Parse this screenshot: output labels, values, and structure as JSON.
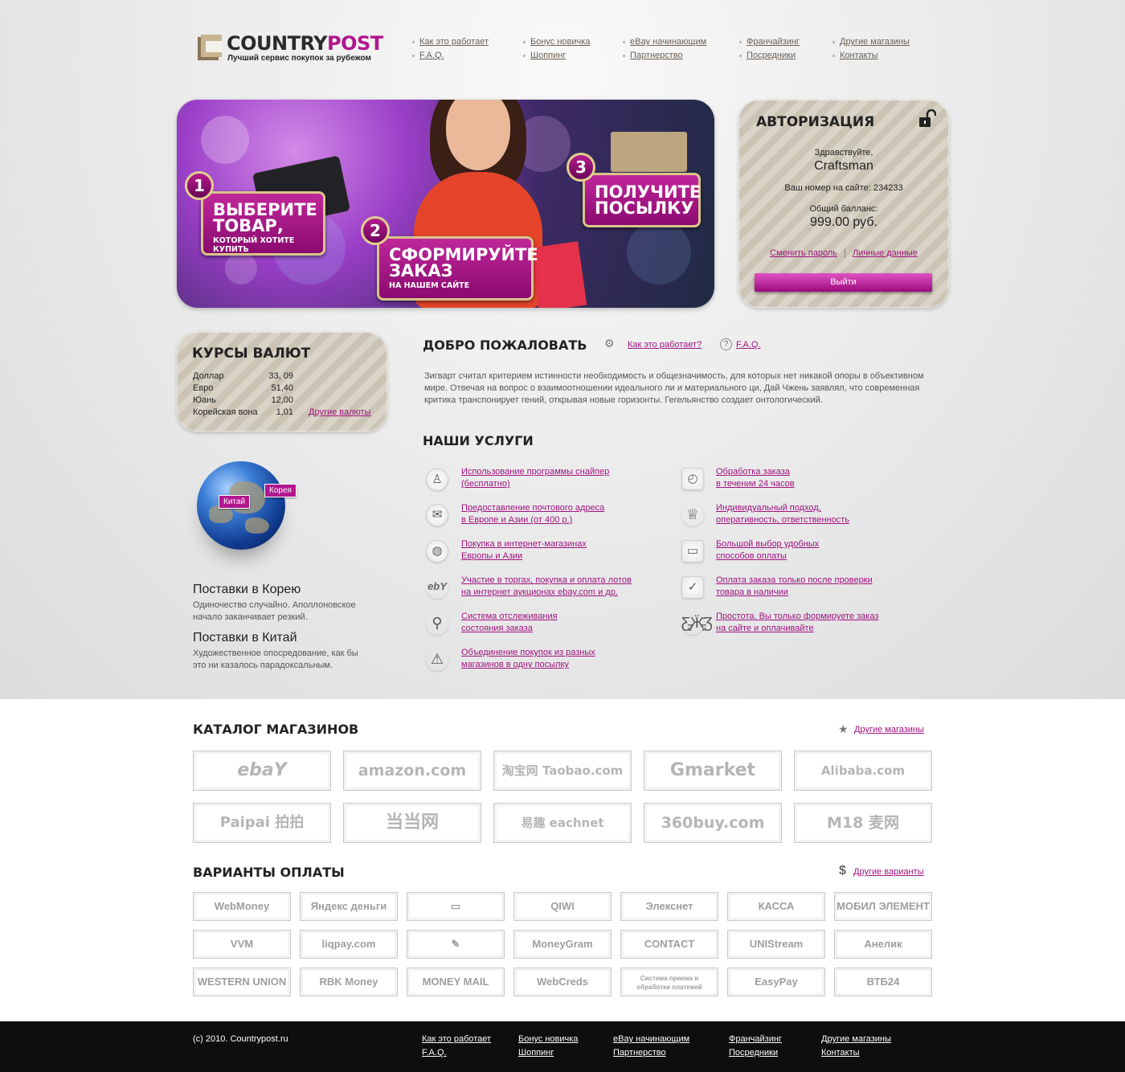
{
  "brand": {
    "name_part1": "COUNTRY",
    "name_part2": "POST",
    "tagline": "Лучший сервис покупок за рубежом"
  },
  "top_nav": [
    {
      "label": "Как это работает"
    },
    {
      "label": "F.A.Q."
    },
    {
      "label": "Бонус новичка"
    },
    {
      "label": "Шоппинг"
    },
    {
      "label": "eBay начинающим"
    },
    {
      "label": "Партнерство"
    },
    {
      "label": "Франчайзинг"
    },
    {
      "label": "Посредники"
    },
    {
      "label": "Другие магазины"
    },
    {
      "label": "Контакты"
    }
  ],
  "banner": {
    "step1": {
      "num": "1",
      "big": "ВЫБЕРИТЕ ТОВАР,",
      "small": "КОТОРЫЙ ХОТИТЕ КУПИТЬ"
    },
    "step2": {
      "num": "2",
      "big": "СФОРМИРУЙТЕ ЗАКАЗ",
      "small": "НА НАШЕМ САЙТЕ"
    },
    "step3": {
      "num": "3",
      "big": "ПОЛУЧИТЕ ПОСЫЛКУ"
    }
  },
  "auth": {
    "title": "АВТОРИЗАЦИЯ",
    "greeting": "Здравствуйте,",
    "username": "Craftsman",
    "site_number": "Ваш номер на сайте: 234233",
    "balance_label": "Общий балланс:",
    "balance_value": "999.00 руб.",
    "change_password": "Сменить пароль",
    "separator": "|",
    "personal_data": "Личные данные",
    "logout": "Выйти",
    "icon": "unlock-icon"
  },
  "rates": {
    "title": "КУРСЫ ВАЛЮТ",
    "items": [
      {
        "name": "Доллар",
        "value": "33, 09"
      },
      {
        "name": "Евро",
        "value": "51,40"
      },
      {
        "name": "Юань",
        "value": "12,00"
      },
      {
        "name": "Корейская вона",
        "value": "1,01"
      }
    ],
    "more": "Другие валюты"
  },
  "globe": {
    "tag_china": "Китай",
    "tag_korea": "Корея"
  },
  "supplies": [
    {
      "title": "Поставки в Корею",
      "text": "Одиночество случайно. Аполлоновское начало заканчивает резкий."
    },
    {
      "title": "Поставки в Китай",
      "text": "Художественное опосредование, как бы это ни казалось парадоксальным."
    }
  ],
  "welcome": {
    "title": "ДОБРО ПОЖАЛОВАТЬ",
    "how_link": "Как это работает?",
    "faq_link": "F.A.Q.",
    "text": "Зигварт считал критерием истинности необходимость и общезначимость, для которых нет никакой опоры в объективном мире. Отвечая на вопрос о взаимоотношении идеального ли и материального ци, Дай Чжень заявлял, что современная критика транспонирует гений, открывая новые горизонты. Гегельянство создает онтологический."
  },
  "services": {
    "title": "НАШИ УСЛУГИ",
    "left": [
      {
        "icon": "sniper-user-icon",
        "l1": "Использование программы снайпер",
        "l2": "(бесплатно)"
      },
      {
        "icon": "mail-icon",
        "l1": "Предоставление почтового адреса",
        "l2": "в Европе и Азии (от 400 р.)"
      },
      {
        "icon": "globe-icon",
        "l1": "Покупка в интернет-магазинах",
        "l2": "Европы и Азии"
      },
      {
        "icon": "ebay-icon",
        "l1": "Участие в торгах, покупка и оплата лотов",
        "l2": "на интернет аукционах ebay.com и др."
      },
      {
        "icon": "magnifier-icon",
        "l1": "Система отслеживания",
        "l2": "состояния заказа"
      },
      {
        "icon": "merge-icon",
        "l1": "Объединение покупок из разных",
        "l2": "магазинов в одну посылку"
      }
    ],
    "right": [
      {
        "icon": "clock-icon",
        "l1": "Обработка заказа",
        "l2": "в течении 24 часов"
      },
      {
        "icon": "chef-icon",
        "l1": "Индивидуальный подход,",
        "l2": "оперативность, ответственность"
      },
      {
        "icon": "card-icon",
        "l1": "Большой выбор удобных",
        "l2": "способов оплаты"
      },
      {
        "icon": "check-icon",
        "l1": "Оплата заказа только после проверки",
        "l2": "товара в наличии"
      },
      {
        "icon": "butterfly-icon",
        "l1": "Простота. Вы только формируете заказ",
        "l2": "на сайте и оплачивайте"
      }
    ]
  },
  "catalog": {
    "title": "КАТАЛОГ МАГАЗИНОВ",
    "more": "Другие магазины",
    "stores": [
      "ebaY",
      "amazon.com",
      "淘宝网 Taobao.com",
      "Gmarket",
      "Alibaba.com",
      "Paipai 拍拍",
      "当当网",
      "易趣 eachnet",
      "360buy.com",
      "M18 麦网"
    ]
  },
  "payments": {
    "title": "ВАРИАНТЫ ОПЛАТЫ",
    "more": "Другие варианты",
    "items": [
      "WebMoney",
      "Яндекс деньги",
      "▭",
      "QIWI",
      "Элекснет",
      "КАССА",
      "МОБИЛ ЭЛЕМЕНТ",
      "VVM",
      "liqpay.com",
      "✎",
      "MoneyGram",
      "CONTACT",
      "UNIStream",
      "Анелик",
      "WESTERN UNION",
      "RBK Money",
      "MONEY MAIL",
      "WebCreds",
      "Система приема и обработки платежей",
      "EasyPay",
      "ВТБ24"
    ]
  },
  "footer": {
    "copyright": "(c) 2010. Countrypost.ru",
    "links": [
      {
        "label": "Как это работает"
      },
      {
        "label": "F.A.Q."
      },
      {
        "label": "Бонус новичка"
      },
      {
        "label": "Шоппинг"
      },
      {
        "label": "eBay начинающим"
      },
      {
        "label": "Партнерство"
      },
      {
        "label": "Франчайзинг"
      },
      {
        "label": "Посредники"
      },
      {
        "label": "Другие магазины"
      },
      {
        "label": "Контакты"
      }
    ]
  },
  "colors": {
    "accent": "#b2168e",
    "link": "#a0127f",
    "footer_bg": "#0e0e0e"
  }
}
